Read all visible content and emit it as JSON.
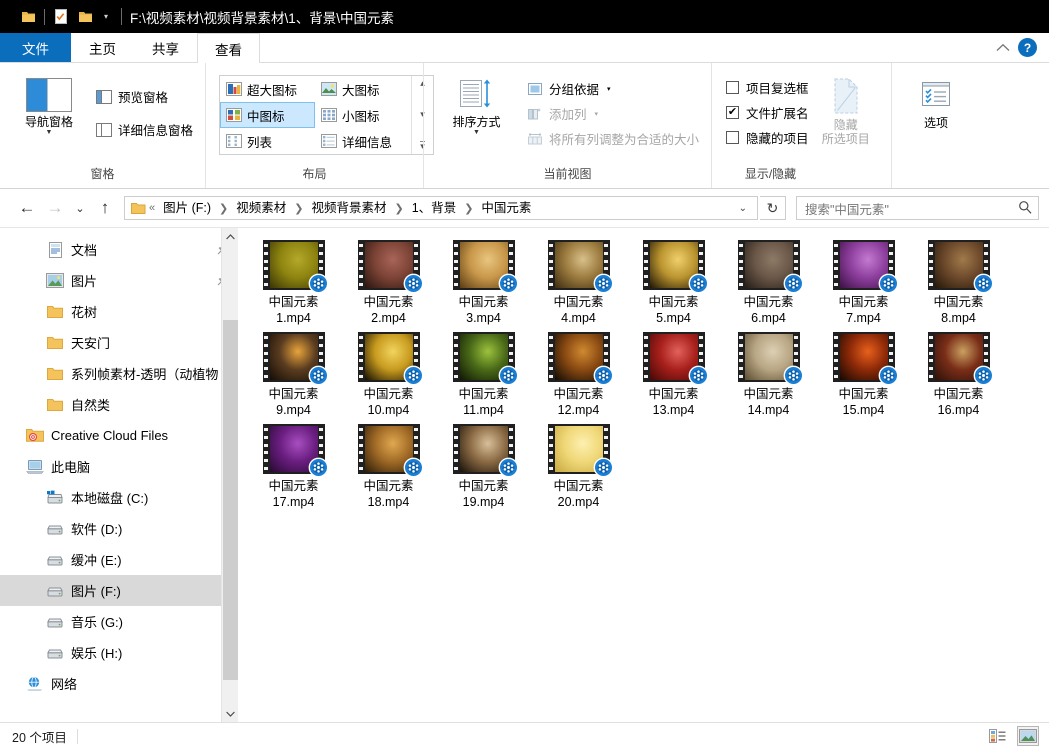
{
  "titlebar": {
    "path": "F:\\视频素材\\视频背景素材\\1、背景\\中国元素",
    "qat": [
      {
        "name": "folder-icon",
        "label": "文件夹"
      },
      {
        "name": "properties-icon",
        "label": "属性"
      },
      {
        "name": "new-folder-icon",
        "label": "新建文件夹"
      }
    ],
    "customize_label": "自定义快速访问工具栏"
  },
  "tabs": [
    {
      "label": "文件",
      "kind": "file"
    },
    {
      "label": "主页",
      "kind": "normal"
    },
    {
      "label": "共享",
      "kind": "normal"
    },
    {
      "label": "查看",
      "kind": "active"
    }
  ],
  "tabstrip_right": {
    "collapse_label": "︿",
    "help_label": "?"
  },
  "ribbon": {
    "groups": [
      {
        "name": "panes",
        "label": "窗格",
        "big_button": {
          "label": "导航窗格",
          "caret": "▼"
        },
        "items": [
          {
            "label": "预览窗格",
            "icon": "preview-pane-icon"
          },
          {
            "label": "详细信息窗格",
            "icon": "details-pane-icon"
          }
        ]
      },
      {
        "name": "layout",
        "label": "布局",
        "options": [
          {
            "label": "超大图标",
            "selected": false
          },
          {
            "label": "大图标",
            "selected": false
          },
          {
            "label": "中图标",
            "selected": true
          },
          {
            "label": "小图标",
            "selected": false
          },
          {
            "label": "列表",
            "selected": false
          },
          {
            "label": "详细信息",
            "selected": false
          }
        ],
        "spinner": {
          "up": "▴",
          "down": "▾",
          "more": "▾"
        }
      },
      {
        "name": "current-view",
        "label": "当前视图",
        "big_button": {
          "label": "排序方式",
          "caret": "▼"
        },
        "items": [
          {
            "label": "分组依据",
            "caret": "▾",
            "disabled": false
          },
          {
            "label": "添加列",
            "caret": "▾",
            "disabled": true
          },
          {
            "label": "将所有列调整为合适的大小",
            "caret": "",
            "disabled": true
          }
        ]
      },
      {
        "name": "show-hide",
        "label": "显示/隐藏",
        "checkboxes": [
          {
            "label": "项目复选框",
            "checked": false
          },
          {
            "label": "文件扩展名",
            "checked": true
          },
          {
            "label": "隐藏的项目",
            "checked": false
          }
        ],
        "hide_button": {
          "line1": "隐藏",
          "line2": "所选项目"
        }
      },
      {
        "name": "options",
        "label": "",
        "button": {
          "label": "选项"
        }
      }
    ]
  },
  "addressbar": {
    "back": "←",
    "forward": "→",
    "recent": "⌄",
    "up": "↑",
    "overflow": "«",
    "crumbs": [
      "图片 (F:)",
      "视频素材",
      "视频背景素材",
      "1、背景",
      "中国元素"
    ],
    "dropdown": "⌄",
    "refresh": "↻",
    "search_placeholder": "搜索\"中国元素\""
  },
  "sidebar": {
    "items": [
      {
        "label": "文档",
        "icon": "documents-icon",
        "indent": 2,
        "pinned": true,
        "selected": false
      },
      {
        "label": "图片",
        "icon": "pictures-icon",
        "indent": 2,
        "pinned": true,
        "selected": false
      },
      {
        "label": "花树",
        "icon": "folder-icon",
        "indent": 2,
        "pinned": false,
        "selected": false
      },
      {
        "label": "天安门",
        "icon": "folder-icon",
        "indent": 2,
        "pinned": false,
        "selected": false
      },
      {
        "label": "系列帧素材-透明（动植物",
        "icon": "folder-icon",
        "indent": 2,
        "pinned": false,
        "selected": false
      },
      {
        "label": "自然类",
        "icon": "folder-icon",
        "indent": 2,
        "pinned": false,
        "selected": false
      },
      {
        "label": "Creative Cloud Files",
        "icon": "creative-cloud-icon",
        "indent": 1,
        "pinned": false,
        "selected": false
      },
      {
        "label": "此电脑",
        "icon": "this-pc-icon",
        "indent": 1,
        "pinned": false,
        "selected": false
      },
      {
        "label": "本地磁盘 (C:)",
        "icon": "windows-drive-icon",
        "indent": 2,
        "pinned": false,
        "selected": false
      },
      {
        "label": "软件 (D:)",
        "icon": "drive-icon",
        "indent": 2,
        "pinned": false,
        "selected": false
      },
      {
        "label": "缓冲 (E:)",
        "icon": "drive-icon",
        "indent": 2,
        "pinned": false,
        "selected": false
      },
      {
        "label": "图片 (F:)",
        "icon": "drive-icon",
        "indent": 2,
        "pinned": false,
        "selected": true
      },
      {
        "label": "音乐 (G:)",
        "icon": "drive-icon",
        "indent": 2,
        "pinned": false,
        "selected": false
      },
      {
        "label": "娱乐 (H:)",
        "icon": "drive-icon",
        "indent": 2,
        "pinned": false,
        "selected": false
      },
      {
        "label": "网络",
        "icon": "network-icon",
        "indent": 1,
        "pinned": false,
        "selected": false
      }
    ],
    "scrollbar": {
      "up": "⌃",
      "down": "⌄"
    }
  },
  "files": [
    {
      "name": "中国元素\n1.mp4",
      "line1": "中国元素",
      "line2": "1.mp4",
      "c1": "#8d8410",
      "c2": "#3a3405",
      "c3": "#b5a82a"
    },
    {
      "name": "中国元素\n2.mp4",
      "line1": "中国元素",
      "line2": "2.mp4",
      "c1": "#7d4436",
      "c2": "#2a1410",
      "c3": "#a9645a"
    },
    {
      "name": "中国元素\n3.mp4",
      "line1": "中国元素",
      "line2": "3.mp4",
      "c1": "#c8974a",
      "c2": "#5a3c12",
      "c3": "#e8c57e"
    },
    {
      "name": "中国元素\n4.mp4",
      "line1": "中国元素",
      "line2": "4.mp4",
      "c1": "#9c7b3e",
      "c2": "#3c2c10",
      "c3": "#d8c08a"
    },
    {
      "name": "中国元素\n5.mp4",
      "line1": "中国元素",
      "line2": "5.mp4",
      "c1": "#b9932f",
      "c2": "#1c1405",
      "c3": "#f0d06a"
    },
    {
      "name": "中国元素\n6.mp4",
      "line1": "中国元素",
      "line2": "6.mp4",
      "c1": "#6a5748",
      "c2": "#241c16",
      "c3": "#8d7a66"
    },
    {
      "name": "中国元素\n7.mp4",
      "line1": "中国元素",
      "line2": "7.mp4",
      "c1": "#8e3f9e",
      "c2": "#3c1044",
      "c3": "#c47ad0"
    },
    {
      "name": "中国元素\n8.mp4",
      "line1": "中国元素",
      "line2": "8.mp4",
      "c1": "#6e4a2c",
      "c2": "#241708",
      "c3": "#a07a4a"
    },
    {
      "name": "中国元素\n9.mp4",
      "line1": "中国元素",
      "line2": "9.mp4",
      "c1": "#5a3c20",
      "c2": "#140c06",
      "c3": "#e8a43c"
    },
    {
      "name": "中国元素\n10.mp4",
      "line1": "中国元素",
      "line2": "10.mp4",
      "c1": "#c79a1e",
      "c2": "#120d02",
      "c3": "#f2d45e"
    },
    {
      "name": "中国元素\n11.mp4",
      "line1": "中国元素",
      "line2": "11.mp4",
      "c1": "#4a6a18",
      "c2": "#0e1604",
      "c3": "#9cc23c"
    },
    {
      "name": "中国元素\n12.mp4",
      "line1": "中国元素",
      "line2": "12.mp4",
      "c1": "#8a4a12",
      "c2": "#100a04",
      "c3": "#d08a30"
    },
    {
      "name": "中国元素\n13.mp4",
      "line1": "中国元素",
      "line2": "13.mp4",
      "c1": "#a8201c",
      "c2": "#460806",
      "c3": "#e2625a"
    },
    {
      "name": "中国元素\n14.mp4",
      "line1": "中国元素",
      "line2": "14.mp4",
      "c1": "#b8a684",
      "c2": "#5c4c30",
      "c3": "#ddd0b4"
    },
    {
      "name": "中国元素\n15.mp4",
      "line1": "中国元素",
      "line2": "15.mp4",
      "c1": "#8e2a08",
      "c2": "#140802",
      "c3": "#e8601c"
    },
    {
      "name": "中国元素\n16.mp4",
      "line1": "中国元素",
      "line2": "16.mp4",
      "c1": "#7a2e18",
      "c2": "#2c1008",
      "c3": "#caa060"
    },
    {
      "name": "中国元素\n17.mp4",
      "line1": "中国元素",
      "line2": "17.mp4",
      "c1": "#6a1e80",
      "c2": "#260a30",
      "c3": "#a84ec0"
    },
    {
      "name": "中国元素\n18.mp4",
      "line1": "中国元素",
      "line2": "18.mp4",
      "c1": "#a06a26",
      "c2": "#2c1c08",
      "c3": "#e0a850"
    },
    {
      "name": "中国元素\n19.mp4",
      "line1": "中国元素",
      "line2": "19.mp4",
      "c1": "#8a6a44",
      "c2": "#181008",
      "c3": "#d8c09a"
    },
    {
      "name": "中国元素\n20.mp4",
      "line1": "中国元素",
      "line2": "20.mp4",
      "c1": "#f0d878",
      "c2": "#c8a840",
      "c3": "#fdf0b0"
    }
  ],
  "statusbar": {
    "item_count": "20 个项目",
    "views": [
      {
        "name": "details-view",
        "selected": false
      },
      {
        "name": "large-icons-view",
        "selected": true
      }
    ]
  },
  "colors": {
    "accent": "#0b6ebd",
    "titlebar_bg": "#000000",
    "selection": "#cce8ff",
    "nav_selection": "#d9d9d9"
  }
}
